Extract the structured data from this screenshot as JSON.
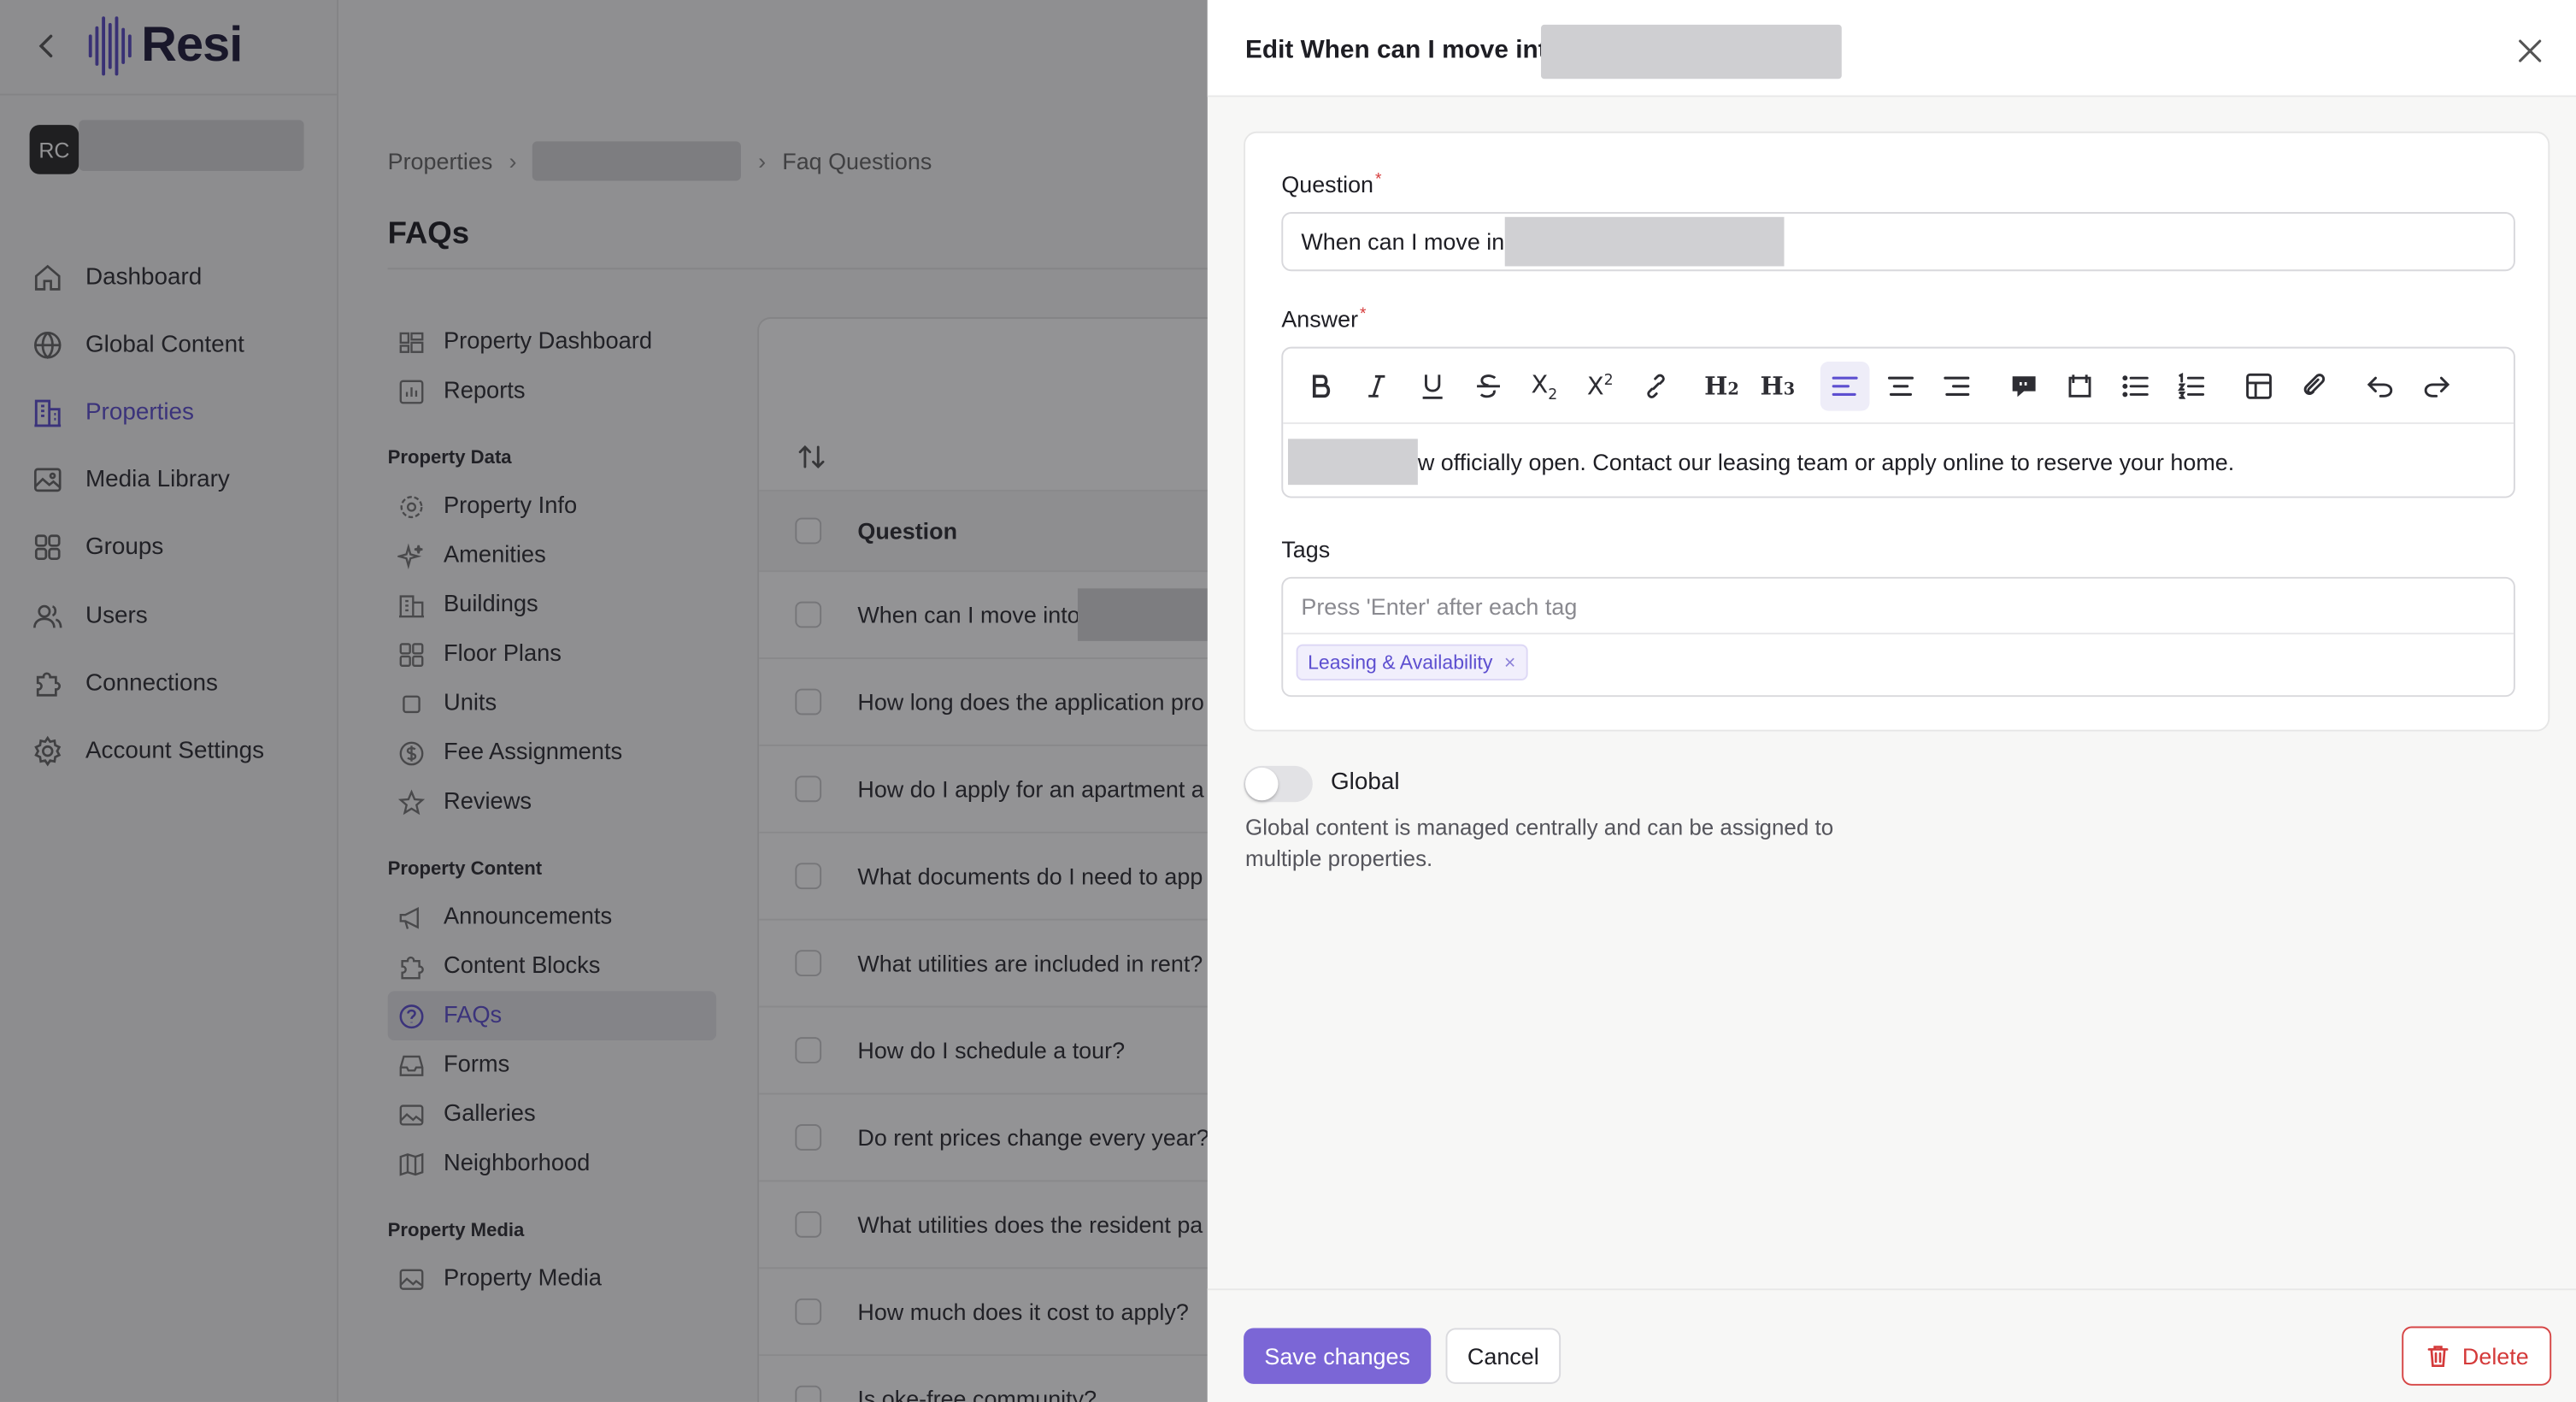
{
  "brand": {
    "name": "Resi"
  },
  "org": {
    "initials": "RC"
  },
  "nav": [
    {
      "label": "Dashboard",
      "icon": "home-icon",
      "active": false
    },
    {
      "label": "Global Content",
      "icon": "globe-icon",
      "active": false
    },
    {
      "label": "Properties",
      "icon": "building-icon",
      "active": true
    },
    {
      "label": "Media Library",
      "icon": "image-icon",
      "active": false
    },
    {
      "label": "Groups",
      "icon": "grid-icon",
      "active": false
    },
    {
      "label": "Users",
      "icon": "users-icon",
      "active": false
    },
    {
      "label": "Connections",
      "icon": "puzzle-icon",
      "active": false
    },
    {
      "label": "Account Settings",
      "icon": "gear-icon",
      "active": false
    }
  ],
  "breadcrumb": {
    "root": "Properties",
    "current": "Faq Questions"
  },
  "page": {
    "title": "FAQs"
  },
  "subnav": {
    "top": [
      {
        "label": "Property Dashboard",
        "icon": "dashboard-icon"
      },
      {
        "label": "Reports",
        "icon": "chart-icon"
      }
    ],
    "sections": [
      {
        "heading": "Property Data",
        "items": [
          {
            "label": "Property Info",
            "icon": "gear-icon"
          },
          {
            "label": "Amenities",
            "icon": "sparkle-icon"
          },
          {
            "label": "Buildings",
            "icon": "building-icon"
          },
          {
            "label": "Floor Plans",
            "icon": "grid-icon"
          },
          {
            "label": "Units",
            "icon": "square-icon"
          },
          {
            "label": "Fee Assignments",
            "icon": "dollar-icon"
          },
          {
            "label": "Reviews",
            "icon": "star-icon"
          }
        ]
      },
      {
        "heading": "Property Content",
        "items": [
          {
            "label": "Announcements",
            "icon": "megaphone-icon"
          },
          {
            "label": "Content Blocks",
            "icon": "puzzle-icon"
          },
          {
            "label": "FAQs",
            "icon": "question-icon",
            "active": true
          },
          {
            "label": "Forms",
            "icon": "inbox-icon"
          },
          {
            "label": "Galleries",
            "icon": "image-icon"
          },
          {
            "label": "Neighborhood",
            "icon": "map-icon"
          }
        ]
      },
      {
        "heading": "Property Media",
        "items": [
          {
            "label": "Property Media",
            "icon": "image-icon"
          }
        ]
      }
    ]
  },
  "table": {
    "column_question": "Question",
    "rows": [
      "When can I move into",
      "How long does the application pro",
      "How do I apply for an apartment a",
      "What documents do I need to app",
      "What utilities are included in rent?",
      "How do I schedule a tour?",
      "Do rent prices change every year?",
      "What utilities does the resident pa",
      "How much does it cost to apply?",
      "Is                  oke-free community?"
    ]
  },
  "drawer": {
    "title": "Edit When can I move int",
    "question_label": "Question",
    "question_value": "When can I move in",
    "answer_label": "Answer",
    "answer_text": "w officially open. Contact our leasing team or apply online to reserve your home.",
    "tags_label": "Tags",
    "tags_placeholder": "Press 'Enter' after each tag",
    "tags": [
      "Leasing & Availability"
    ],
    "global_label": "Global",
    "global_on": false,
    "global_desc": "Global content is managed centrally and can be assigned to multiple properties.",
    "save_label": "Save changes",
    "cancel_label": "Cancel",
    "delete_label": "Delete"
  },
  "toolbar_buttons": [
    {
      "name": "bold-button",
      "icon": "bold-icon"
    },
    {
      "name": "italic-button",
      "icon": "italic-icon"
    },
    {
      "name": "underline-button",
      "icon": "underline-icon"
    },
    {
      "name": "strikethrough-button",
      "icon": "strikethrough-icon"
    },
    {
      "name": "subscript-button",
      "icon": "subscript-icon"
    },
    {
      "name": "superscript-button",
      "icon": "superscript-icon"
    },
    {
      "name": "link-button",
      "icon": "link-icon"
    },
    {
      "name": "heading-2-button",
      "icon": "h2-icon"
    },
    {
      "name": "heading-3-button",
      "icon": "h3-icon"
    },
    {
      "name": "align-left-button",
      "icon": "align-left-icon",
      "active": true
    },
    {
      "name": "align-center-button",
      "icon": "align-center-icon"
    },
    {
      "name": "align-right-button",
      "icon": "align-right-icon"
    },
    {
      "name": "comment-button",
      "icon": "comment-icon"
    },
    {
      "name": "bookmark-button",
      "icon": "bookmark-icon"
    },
    {
      "name": "bullet-list-button",
      "icon": "bullet-list-icon"
    },
    {
      "name": "ordered-list-button",
      "icon": "ordered-list-icon"
    },
    {
      "name": "table-button",
      "icon": "table-icon"
    },
    {
      "name": "attach-link-button",
      "icon": "attach-icon"
    },
    {
      "name": "undo-button",
      "icon": "undo-icon"
    },
    {
      "name": "redo-button",
      "icon": "redo-icon"
    }
  ],
  "colors": {
    "accent": "#5d4fd0",
    "save_button": "#7b66d6",
    "danger": "#d43a3a"
  }
}
